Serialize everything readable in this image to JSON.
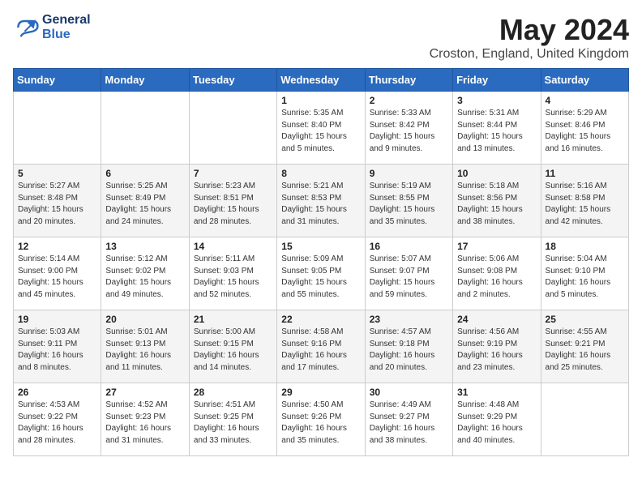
{
  "header": {
    "logo_line1": "General",
    "logo_line2": "Blue",
    "month": "May 2024",
    "location": "Croston, England, United Kingdom"
  },
  "weekdays": [
    "Sunday",
    "Monday",
    "Tuesday",
    "Wednesday",
    "Thursday",
    "Friday",
    "Saturday"
  ],
  "weeks": [
    [
      {
        "day": "",
        "info": ""
      },
      {
        "day": "",
        "info": ""
      },
      {
        "day": "",
        "info": ""
      },
      {
        "day": "1",
        "info": "Sunrise: 5:35 AM\nSunset: 8:40 PM\nDaylight: 15 hours\nand 5 minutes."
      },
      {
        "day": "2",
        "info": "Sunrise: 5:33 AM\nSunset: 8:42 PM\nDaylight: 15 hours\nand 9 minutes."
      },
      {
        "day": "3",
        "info": "Sunrise: 5:31 AM\nSunset: 8:44 PM\nDaylight: 15 hours\nand 13 minutes."
      },
      {
        "day": "4",
        "info": "Sunrise: 5:29 AM\nSunset: 8:46 PM\nDaylight: 15 hours\nand 16 minutes."
      }
    ],
    [
      {
        "day": "5",
        "info": "Sunrise: 5:27 AM\nSunset: 8:48 PM\nDaylight: 15 hours\nand 20 minutes."
      },
      {
        "day": "6",
        "info": "Sunrise: 5:25 AM\nSunset: 8:49 PM\nDaylight: 15 hours\nand 24 minutes."
      },
      {
        "day": "7",
        "info": "Sunrise: 5:23 AM\nSunset: 8:51 PM\nDaylight: 15 hours\nand 28 minutes."
      },
      {
        "day": "8",
        "info": "Sunrise: 5:21 AM\nSunset: 8:53 PM\nDaylight: 15 hours\nand 31 minutes."
      },
      {
        "day": "9",
        "info": "Sunrise: 5:19 AM\nSunset: 8:55 PM\nDaylight: 15 hours\nand 35 minutes."
      },
      {
        "day": "10",
        "info": "Sunrise: 5:18 AM\nSunset: 8:56 PM\nDaylight: 15 hours\nand 38 minutes."
      },
      {
        "day": "11",
        "info": "Sunrise: 5:16 AM\nSunset: 8:58 PM\nDaylight: 15 hours\nand 42 minutes."
      }
    ],
    [
      {
        "day": "12",
        "info": "Sunrise: 5:14 AM\nSunset: 9:00 PM\nDaylight: 15 hours\nand 45 minutes."
      },
      {
        "day": "13",
        "info": "Sunrise: 5:12 AM\nSunset: 9:02 PM\nDaylight: 15 hours\nand 49 minutes."
      },
      {
        "day": "14",
        "info": "Sunrise: 5:11 AM\nSunset: 9:03 PM\nDaylight: 15 hours\nand 52 minutes."
      },
      {
        "day": "15",
        "info": "Sunrise: 5:09 AM\nSunset: 9:05 PM\nDaylight: 15 hours\nand 55 minutes."
      },
      {
        "day": "16",
        "info": "Sunrise: 5:07 AM\nSunset: 9:07 PM\nDaylight: 15 hours\nand 59 minutes."
      },
      {
        "day": "17",
        "info": "Sunrise: 5:06 AM\nSunset: 9:08 PM\nDaylight: 16 hours\nand 2 minutes."
      },
      {
        "day": "18",
        "info": "Sunrise: 5:04 AM\nSunset: 9:10 PM\nDaylight: 16 hours\nand 5 minutes."
      }
    ],
    [
      {
        "day": "19",
        "info": "Sunrise: 5:03 AM\nSunset: 9:11 PM\nDaylight: 16 hours\nand 8 minutes."
      },
      {
        "day": "20",
        "info": "Sunrise: 5:01 AM\nSunset: 9:13 PM\nDaylight: 16 hours\nand 11 minutes."
      },
      {
        "day": "21",
        "info": "Sunrise: 5:00 AM\nSunset: 9:15 PM\nDaylight: 16 hours\nand 14 minutes."
      },
      {
        "day": "22",
        "info": "Sunrise: 4:58 AM\nSunset: 9:16 PM\nDaylight: 16 hours\nand 17 minutes."
      },
      {
        "day": "23",
        "info": "Sunrise: 4:57 AM\nSunset: 9:18 PM\nDaylight: 16 hours\nand 20 minutes."
      },
      {
        "day": "24",
        "info": "Sunrise: 4:56 AM\nSunset: 9:19 PM\nDaylight: 16 hours\nand 23 minutes."
      },
      {
        "day": "25",
        "info": "Sunrise: 4:55 AM\nSunset: 9:21 PM\nDaylight: 16 hours\nand 25 minutes."
      }
    ],
    [
      {
        "day": "26",
        "info": "Sunrise: 4:53 AM\nSunset: 9:22 PM\nDaylight: 16 hours\nand 28 minutes."
      },
      {
        "day": "27",
        "info": "Sunrise: 4:52 AM\nSunset: 9:23 PM\nDaylight: 16 hours\nand 31 minutes."
      },
      {
        "day": "28",
        "info": "Sunrise: 4:51 AM\nSunset: 9:25 PM\nDaylight: 16 hours\nand 33 minutes."
      },
      {
        "day": "29",
        "info": "Sunrise: 4:50 AM\nSunset: 9:26 PM\nDaylight: 16 hours\nand 35 minutes."
      },
      {
        "day": "30",
        "info": "Sunrise: 4:49 AM\nSunset: 9:27 PM\nDaylight: 16 hours\nand 38 minutes."
      },
      {
        "day": "31",
        "info": "Sunrise: 4:48 AM\nSunset: 9:29 PM\nDaylight: 16 hours\nand 40 minutes."
      },
      {
        "day": "",
        "info": ""
      }
    ]
  ]
}
